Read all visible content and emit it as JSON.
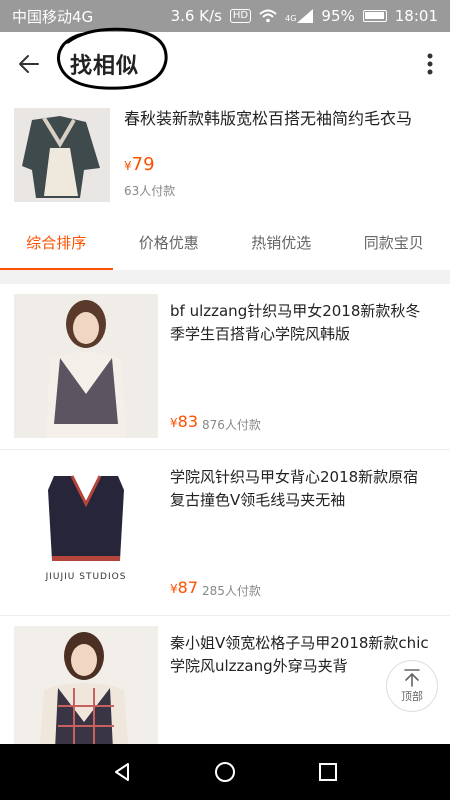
{
  "status_bar": {
    "carrier": "中国移动4G",
    "speed": "3.6 K/s",
    "hd": "HD",
    "network": "4G",
    "battery": "95%",
    "time": "18:01"
  },
  "header": {
    "title": "找相似",
    "back_icon": "arrow-left-icon",
    "more_icon": "more-vertical-icon"
  },
  "source_product": {
    "title": "春秋装新款韩版宽松百搭无袖简约毛衣马",
    "price_symbol": "¥",
    "price": "79",
    "sold": "63人付款"
  },
  "tabs": [
    {
      "label": "综合排序",
      "active": true
    },
    {
      "label": "价格优惠",
      "active": false
    },
    {
      "label": "热销优选",
      "active": false
    },
    {
      "label": "同款宝贝",
      "active": false
    }
  ],
  "items": [
    {
      "title": "bf ulzzang针织马甲女2018新款秋冬季学生百搭背心学院风韩版",
      "price_symbol": "¥",
      "price": "83",
      "sold": "876人付款"
    },
    {
      "title": "学院风针织马甲女背心2018新款原宿复古撞色V领毛线马夹无袖",
      "price_symbol": "¥",
      "price": "87",
      "sold": "285人付款",
      "brand_text": "JIUJIU STUDIOS"
    },
    {
      "title": "秦小姐V领宽松格子马甲2018新款chic学院风ulzzang外穿马夹背",
      "price_symbol": "",
      "price": "",
      "sold": ""
    }
  ],
  "back_to_top": {
    "label": "顶部",
    "icon": "arrow-up-bar-icon"
  },
  "colors": {
    "accent": "#ff5000",
    "status_bar": "#9a9a9a",
    "nav_bar": "#000000"
  }
}
